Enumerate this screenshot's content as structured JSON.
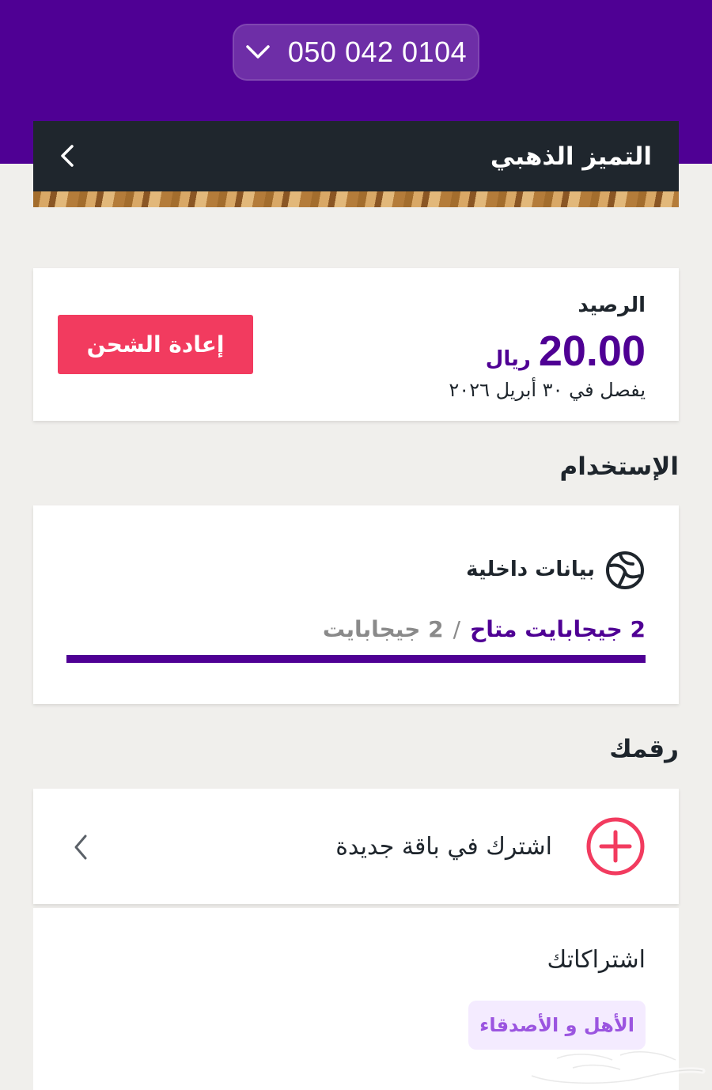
{
  "header": {
    "phone_number": "050 042 0104",
    "plan_title": "التميز الذهبي"
  },
  "balance": {
    "label": "الرصيد",
    "amount": "20.00",
    "currency": "ريال",
    "expiry": "يفصل في ٣٠ أبريل ٢٠٢٦",
    "recharge_label": "إعادة الشحن"
  },
  "usage": {
    "section_title": "الإستخدام",
    "item_label": "بيانات داخلية",
    "available": "2  جيجابايت متاح",
    "separator": "/",
    "total": "2  جيجابايت",
    "fraction_available": 1.0
  },
  "number_section": {
    "section_title": "رقمك",
    "subscribe_label": "اشترك في باقة جديدة",
    "subscriptions_label": "اشتراكاتك",
    "chip_label": "الأهل و الأصدقاء"
  },
  "icons": {
    "pill_chevron": "chevron-down-icon",
    "header_back": "chevron-left-icon",
    "data": "globe-icon",
    "subscribe": "plus-circle-icon",
    "subscribe_chevron": "chevron-left-icon"
  },
  "colors": {
    "brand_purple": "#4f0094",
    "accent_red": "#f23b5f",
    "header_dark": "#1f262d",
    "chip_text": "#9b55e0"
  }
}
